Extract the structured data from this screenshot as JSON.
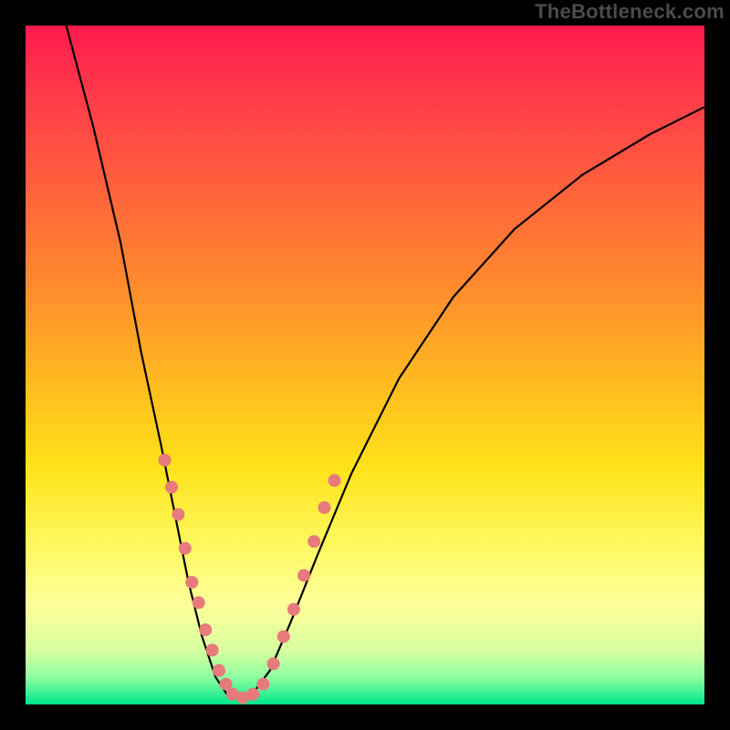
{
  "watermark": "TheBottleneck.com",
  "chart_data": {
    "type": "line",
    "title": "",
    "xlabel": "",
    "ylabel": "",
    "xlim": [
      0,
      100
    ],
    "ylim": [
      0,
      100
    ],
    "background_gradient_stops": [
      {
        "pos": 0,
        "color": "#ff1a4d"
      },
      {
        "pos": 10,
        "color": "#ff3a4a"
      },
      {
        "pos": 22,
        "color": "#ff5c3e"
      },
      {
        "pos": 38,
        "color": "#ff8a2e"
      },
      {
        "pos": 55,
        "color": "#ffc21e"
      },
      {
        "pos": 65,
        "color": "#ffe21a"
      },
      {
        "pos": 76,
        "color": "#fdf85c"
      },
      {
        "pos": 85,
        "color": "#ffff99"
      },
      {
        "pos": 92,
        "color": "#d8ffa0"
      },
      {
        "pos": 96,
        "color": "#8effa0"
      },
      {
        "pos": 100,
        "color": "#00e58a"
      }
    ],
    "series": [
      {
        "name": "bottleneck-curve",
        "stroke": "#000000",
        "points": [
          {
            "x": 6,
            "y": 100
          },
          {
            "x": 10,
            "y": 85
          },
          {
            "x": 14,
            "y": 68
          },
          {
            "x": 17,
            "y": 52
          },
          {
            "x": 20,
            "y": 38
          },
          {
            "x": 22,
            "y": 28
          },
          {
            "x": 24,
            "y": 18
          },
          {
            "x": 26,
            "y": 10
          },
          {
            "x": 28,
            "y": 4
          },
          {
            "x": 30,
            "y": 1
          },
          {
            "x": 33,
            "y": 1
          },
          {
            "x": 36,
            "y": 5
          },
          {
            "x": 39,
            "y": 12
          },
          {
            "x": 43,
            "y": 22
          },
          {
            "x": 48,
            "y": 34
          },
          {
            "x": 55,
            "y": 48
          },
          {
            "x": 63,
            "y": 60
          },
          {
            "x": 72,
            "y": 70
          },
          {
            "x": 82,
            "y": 78
          },
          {
            "x": 92,
            "y": 84
          },
          {
            "x": 100,
            "y": 88
          }
        ]
      }
    ],
    "markers": {
      "color": "#e77a7a",
      "radius": 7,
      "points": [
        {
          "x": 20.5,
          "y": 36
        },
        {
          "x": 21.5,
          "y": 32
        },
        {
          "x": 22.5,
          "y": 28
        },
        {
          "x": 23.5,
          "y": 23
        },
        {
          "x": 24.5,
          "y": 18
        },
        {
          "x": 25.5,
          "y": 15
        },
        {
          "x": 26.5,
          "y": 11
        },
        {
          "x": 27.5,
          "y": 8
        },
        {
          "x": 28.5,
          "y": 5
        },
        {
          "x": 29.5,
          "y": 3
        },
        {
          "x": 30.5,
          "y": 1.5
        },
        {
          "x": 32,
          "y": 1
        },
        {
          "x": 33.5,
          "y": 1.5
        },
        {
          "x": 35,
          "y": 3
        },
        {
          "x": 36.5,
          "y": 6
        },
        {
          "x": 38,
          "y": 10
        },
        {
          "x": 39.5,
          "y": 14
        },
        {
          "x": 41,
          "y": 19
        },
        {
          "x": 42.5,
          "y": 24
        },
        {
          "x": 44,
          "y": 29
        },
        {
          "x": 45.5,
          "y": 33
        }
      ]
    }
  }
}
